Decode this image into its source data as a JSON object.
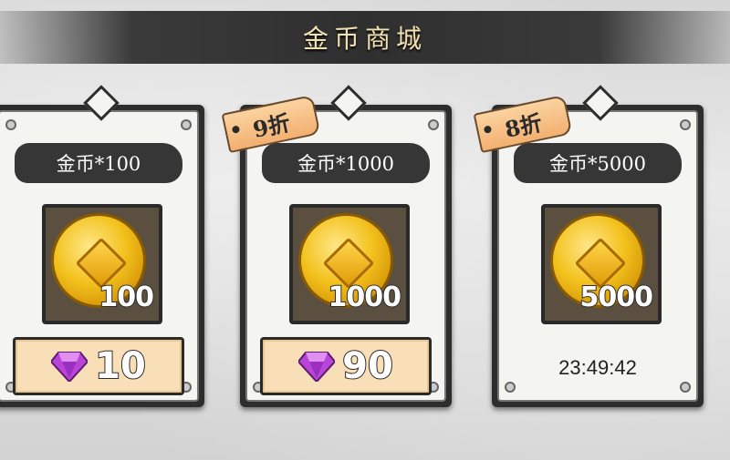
{
  "header": {
    "title": "金币商城"
  },
  "cards": [
    {
      "title": "金币*100",
      "amount": "100",
      "price": "10",
      "discount": ""
    },
    {
      "title": "金币*1000",
      "amount": "1000",
      "price": "90",
      "discount": "9折"
    },
    {
      "title": "金币*5000",
      "amount": "5000",
      "timer": "23:49:42",
      "discount": "8折"
    }
  ],
  "icons": {
    "coin": "gold-coin-icon",
    "currency": "purple-gem-icon"
  },
  "colors": {
    "coin": "#f3c21e",
    "gem": "#b845d8",
    "price_button": "#f9dfb7",
    "tag": "#f3b070"
  }
}
